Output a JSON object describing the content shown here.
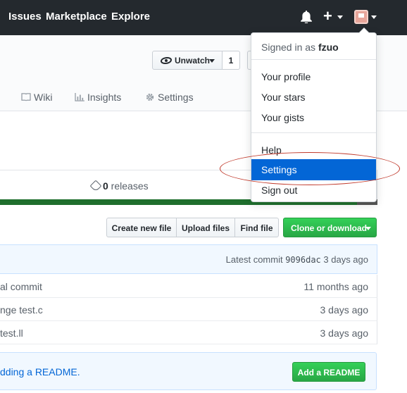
{
  "nav": {
    "issues": "Issues",
    "marketplace": "Marketplace",
    "explore": "Explore",
    "plus": "+"
  },
  "repo": {
    "unwatch_label": "Unwatch",
    "watch_count": "1",
    "tabs": {
      "wiki": "Wiki",
      "insights": "Insights",
      "settings": "Settings"
    },
    "releases_count": "0",
    "releases_label": " releases"
  },
  "file_nav": {
    "create_new_file": "Create new file",
    "upload_files": "Upload files",
    "find_file": "Find file",
    "clone_or_download": "Clone or download"
  },
  "commit": {
    "prefix": "Latest commit ",
    "sha": "9096dac",
    "age": " 3 days ago"
  },
  "files": [
    {
      "message": "al commit",
      "age": "11 months ago"
    },
    {
      "message": "nge test.c",
      "age": "3 days ago"
    },
    {
      "message": " test.ll",
      "age": "3 days ago"
    }
  ],
  "readme": {
    "text": "dding a README.",
    "button": "Add a README"
  },
  "user_menu": {
    "signed_in_as": "Signed in as ",
    "username": "fzuo",
    "your_profile": "Your profile",
    "your_stars": "Your stars",
    "your_gists": "Your gists",
    "help": "Help",
    "settings": "Settings",
    "sign_out": "Sign out"
  },
  "colors": {
    "topbar": "#24292e",
    "active_item": "#0366d6",
    "green_button": "#28a745",
    "annotation": "#c0392b"
  },
  "icons": [
    "bell-icon",
    "plus-icon",
    "avatar",
    "eye-icon",
    "book-icon",
    "graph-icon",
    "gear-icon",
    "tag-icon"
  ]
}
